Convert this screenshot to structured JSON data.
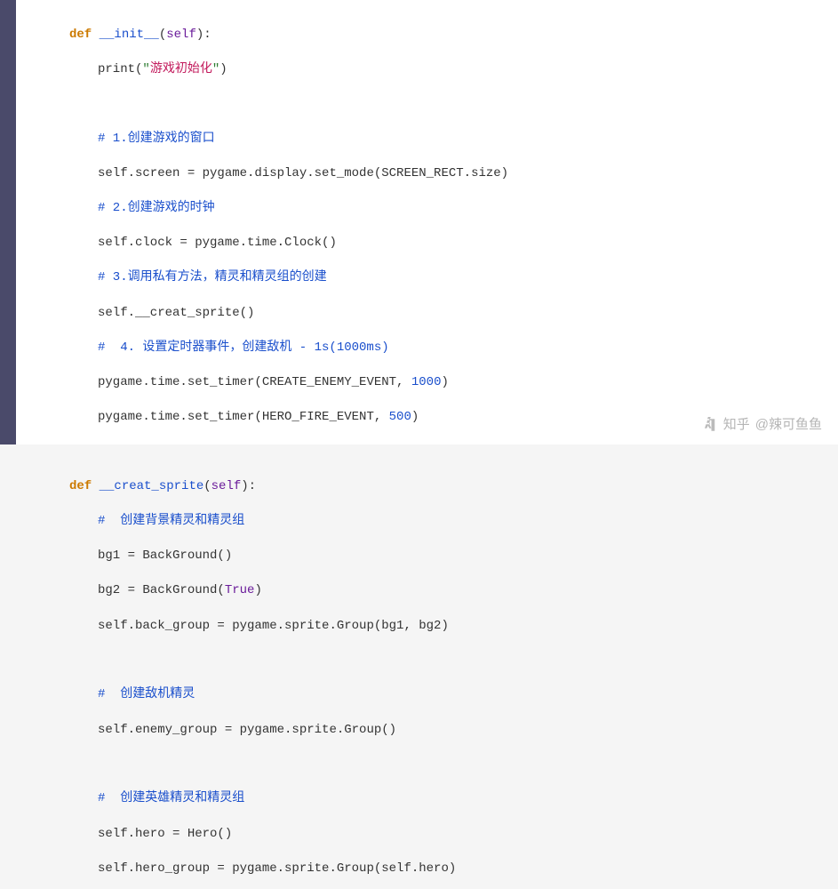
{
  "code": {
    "l1": {
      "kw": "def",
      "fn": "__init__",
      "par": "self"
    },
    "l2": {
      "call": "print",
      "strq": "\"",
      "strzh": "游戏初始化",
      "strq2": "\""
    },
    "l4": "# 1.创建游戏的窗口",
    "l5": {
      "a": "self.screen = pygame.display.set_mode(SCREEN_RECT.size)"
    },
    "l6": "# 2.创建游戏的时钟",
    "l7": {
      "a": "self.clock = pygame.time.Clock()"
    },
    "l8": "# 3.调用私有方法，精灵和精灵组的创建",
    "l9": {
      "a": "self.__creat_sprite()"
    },
    "l10": "#  4. 设置定时器事件，创建敌机 - 1s(1000ms)",
    "l11": {
      "a": "pygame.time.set_timer(CREATE_ENEMY_EVENT, ",
      "n": "1000",
      "b": ")"
    },
    "l12": {
      "a": "pygame.time.set_timer(HERO_FIRE_EVENT, ",
      "n": "500",
      "b": ")"
    },
    "l14": {
      "kw": "def",
      "fn": "__creat_sprite",
      "par": "self"
    },
    "l15": "#  创建背景精灵和精灵组",
    "l16": {
      "a": "bg1 = BackGround()"
    },
    "l17": {
      "a": "bg2 = BackGround(",
      "bool": "True",
      "b": ")"
    },
    "l18": {
      "a": "self.back_group = pygame.sprite.Group(bg1, bg2)"
    },
    "l20": "#  创建敌机精灵",
    "l21": {
      "a": "self.enemy_group = pygame.sprite.Group()"
    },
    "l23": "#  创建英雄精灵和精灵组",
    "l24": {
      "a": "self.hero = Hero()"
    },
    "l25": {
      "a": "self.hero_group = pygame.sprite.Group(self.hero)"
    }
  },
  "watermark": {
    "site": "知乎",
    "author": "@辣可鱼鱼"
  }
}
